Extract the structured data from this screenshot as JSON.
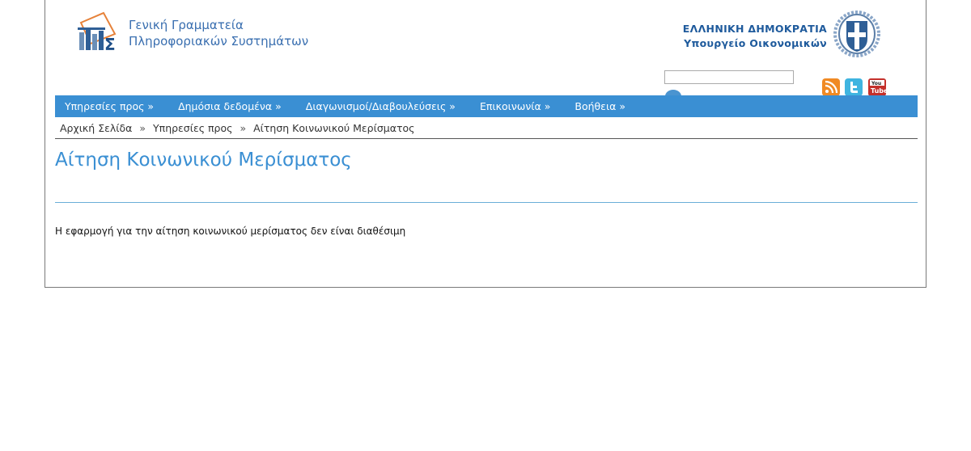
{
  "header": {
    "org_line1": "Γενική Γραμματεία",
    "org_line2": "Πληροφοριακών Συστημάτων",
    "gov_line1": "ΕΛΛΗΝΙΚΗ ΔΗΜΟΚΡΑΤΙΑ",
    "gov_line2": "Υπουργείο Οικονομικών",
    "search_value": "",
    "search_placeholder": ""
  },
  "nav": {
    "items": [
      {
        "label": "Υπηρεσίες προς »"
      },
      {
        "label": "Δημόσια δεδομένα »"
      },
      {
        "label": "Διαγωνισμοί/Διαβουλεύσεις »"
      },
      {
        "label": "Επικοινωνία »"
      },
      {
        "label": "Βοήθεια »"
      }
    ]
  },
  "breadcrumb": {
    "items": [
      "Αρχική Σελίδα",
      "Υπηρεσίες προς",
      "Αίτηση Κοινωνικού Μερίσματος"
    ],
    "separator": "»"
  },
  "main": {
    "title": "Αίτηση Κοινωνικού Μερίσματος",
    "message": "Η εφαρμογή για την αίτηση κοινωνικού μερίσματος δεν είναι διαθέσιμη"
  },
  "colors": {
    "accent": "#3a8fd3",
    "nav_bg": "#3a8fd3",
    "title": "#3a8fd3",
    "org_text": "#3a6fb0",
    "gov_text": "#1e5a9c"
  }
}
